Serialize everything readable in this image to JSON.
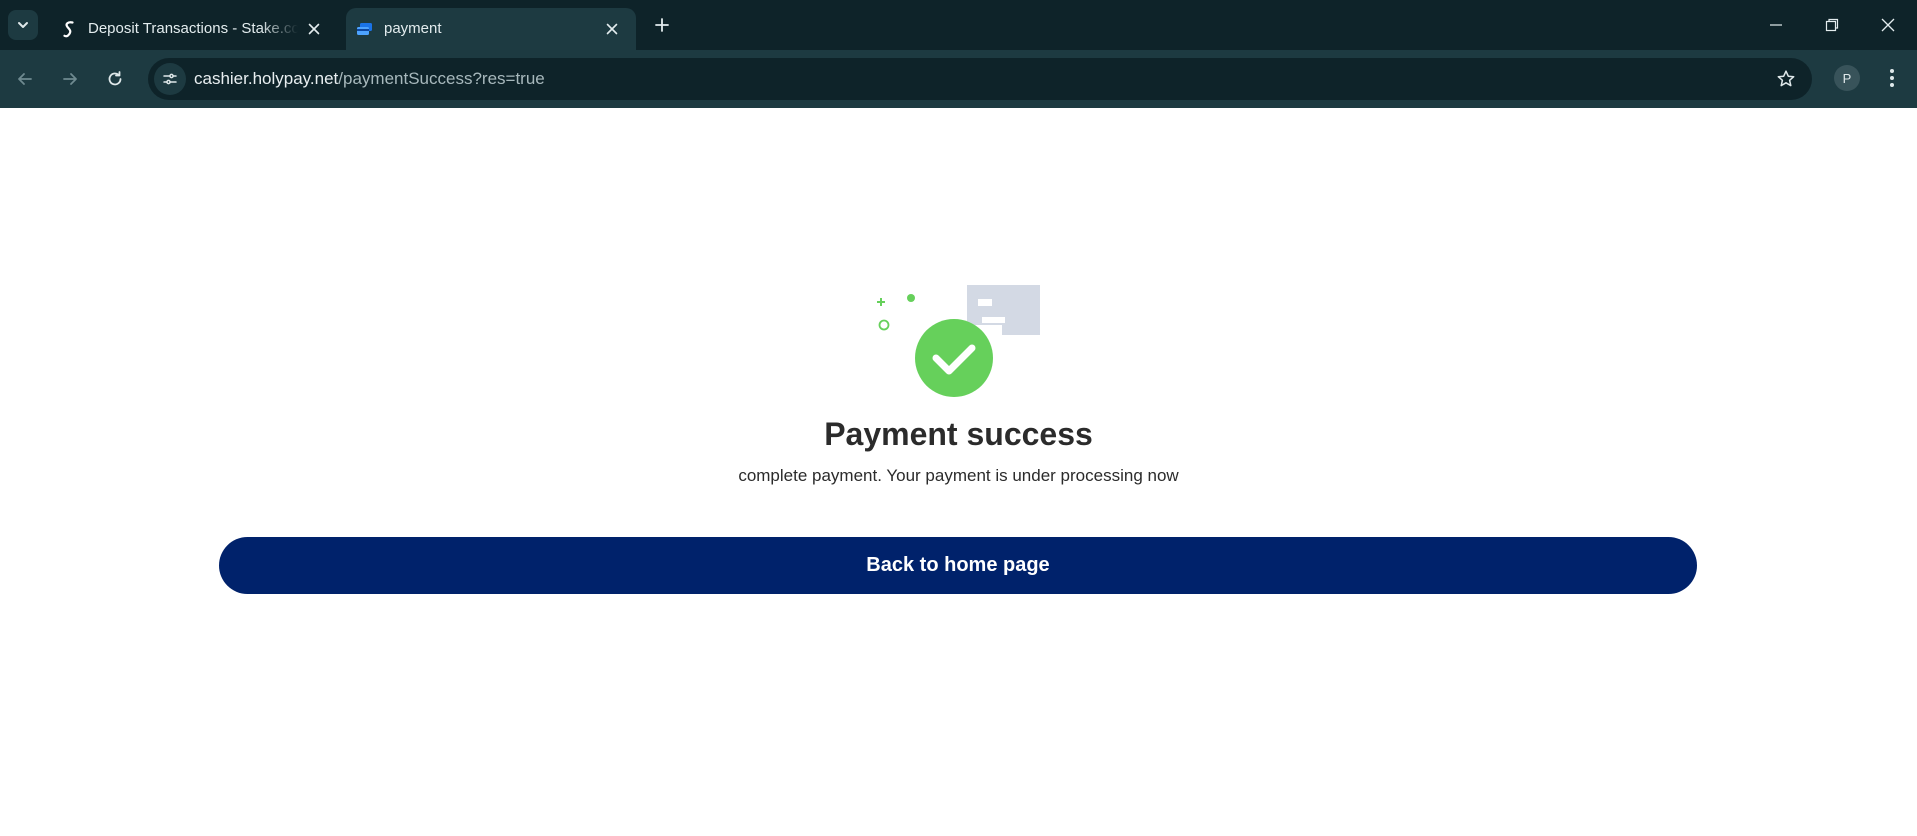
{
  "browser": {
    "tabs": [
      {
        "title": "Deposit Transactions - Stake.com",
        "favicon": "stake-logo-icon",
        "active": false
      },
      {
        "title": "payment",
        "favicon": "holypay-logo-icon",
        "active": true
      }
    ],
    "address_bar": {
      "host": "cashier.holypay.net",
      "path": "/paymentSuccess?res=true"
    },
    "profile_initial": "P",
    "colors": {
      "tabstrip": "#0e2329",
      "toolbar": "#1d3a41"
    }
  },
  "page": {
    "title": "Payment success",
    "subtitle": "complete payment. Your payment is under processing now",
    "button_label": "Back to home page",
    "colors": {
      "success": "#66d05b",
      "button": "#00226b",
      "card": "#d3d9e4"
    }
  }
}
